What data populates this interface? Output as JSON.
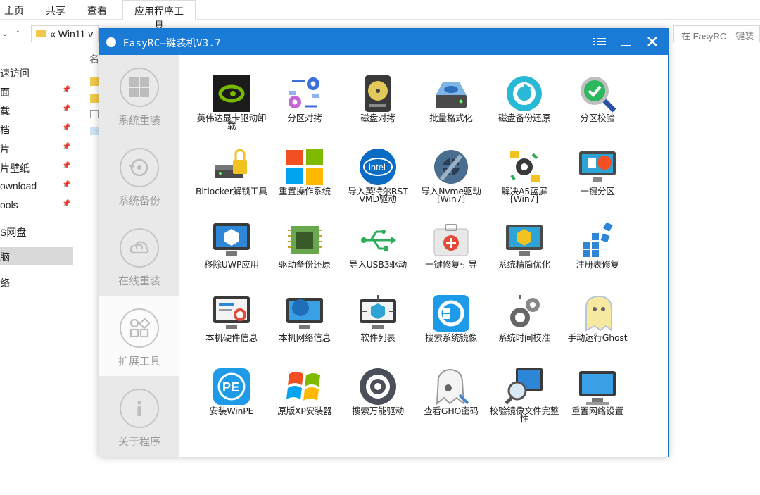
{
  "explorer": {
    "ribbon_tabs": [
      "主页",
      "共享",
      "查看"
    ],
    "tool_tab": "应用程序工具",
    "address_prefix": "«",
    "address": "Win11 v",
    "search_placeholder": "在 EasyRC—键装",
    "column_header": "名",
    "nav_items": [
      {
        "label": "速访问",
        "pinned": false
      },
      {
        "label": "面",
        "pinned": true
      },
      {
        "label": "载",
        "pinned": true
      },
      {
        "label": "档",
        "pinned": true
      },
      {
        "label": "片",
        "pinned": true
      },
      {
        "label": "片壁纸",
        "pinned": true
      },
      {
        "label": "ownload",
        "pinned": true
      },
      {
        "label": "ools",
        "pinned": true
      },
      {
        "label": "S网盘",
        "pinned": false
      },
      {
        "label": "脑",
        "pinned": false,
        "selected": true
      },
      {
        "label": "络",
        "pinned": false
      }
    ]
  },
  "app": {
    "title": "EasyRC—键装机V3.7",
    "accent": "#1a7bd6",
    "sidebar": [
      {
        "label": "系统重装",
        "icon": "windows-icon"
      },
      {
        "label": "系统备份",
        "icon": "backup-icon"
      },
      {
        "label": "在线重装",
        "icon": "cloud-icon"
      },
      {
        "label": "扩展工具",
        "icon": "apps-icon",
        "active": true
      },
      {
        "label": "关于程序",
        "icon": "info-icon"
      }
    ],
    "tools": [
      [
        "英伟达显卡驱动卸载",
        "分区对拷",
        "磁盘对拷",
        "批量格式化",
        "磁盘备份还原",
        "分区校验"
      ],
      [
        "Bitlocker解锁工具",
        "重置操作系统",
        "导入英特尔RST VMD驱动",
        "导入Nvme驱动[Win7]",
        "解决A5蓝屏[Win7]",
        "一键分区"
      ],
      [
        "移除UWP应用",
        "驱动备份还原",
        "导入USB3驱动",
        "一键修复引导",
        "系统精简优化",
        "注册表修复"
      ],
      [
        "本机硬件信息",
        "本机网络信息",
        "软件列表",
        "搜索系统镜像",
        "系统时间校准",
        "手动运行Ghost"
      ],
      [
        "安装WinPE",
        "原版XP安装器",
        "搜索万能驱动",
        "查看GHO密码",
        "校验镜像文件完整性",
        "重置网络设置"
      ]
    ]
  }
}
